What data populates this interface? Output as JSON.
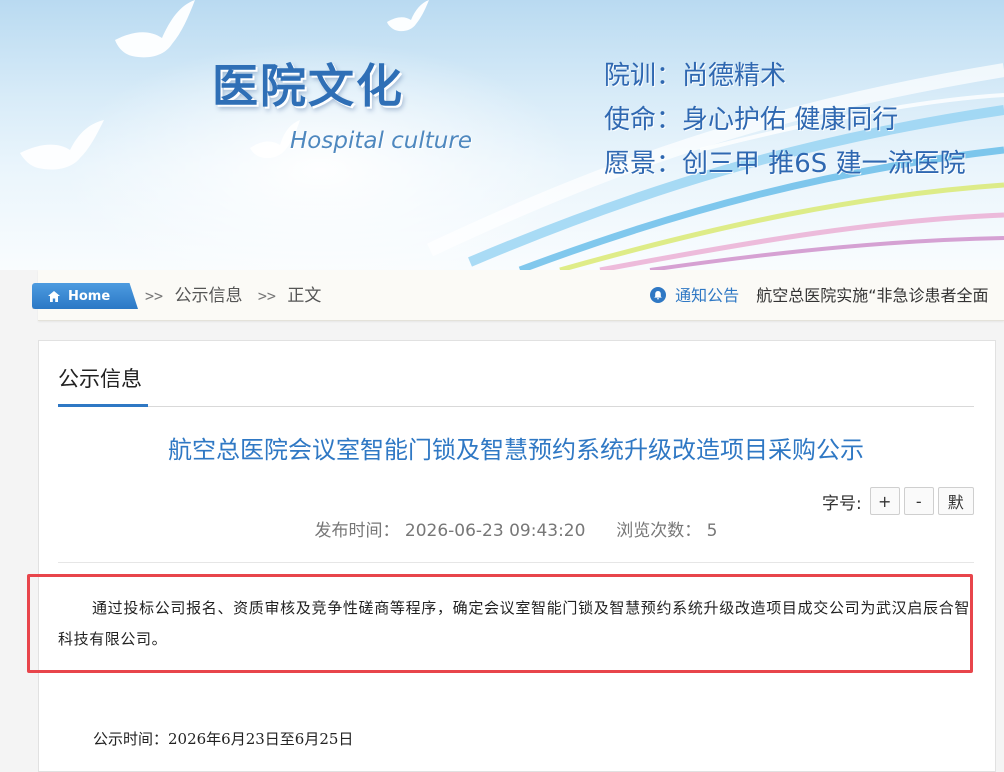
{
  "banner": {
    "title": "医院文化",
    "subtitle": "Hospital culture",
    "mottos": [
      "院训：尚德精术",
      "使命：身心护佑 健康同行",
      "愿景：创三甲 推6S 建一流医院"
    ]
  },
  "breadcrumb": {
    "home_label": "Home",
    "separator": ">>",
    "items": [
      "公示信息",
      "正文"
    ]
  },
  "notice": {
    "label": "通知公告",
    "text": "航空总医院实施“非急诊患者全面"
  },
  "section": {
    "title": "公示信息"
  },
  "article": {
    "title": "航空总医院会议室智能门锁及智慧预约系统升级改造项目采购公示",
    "publish_label": "发布时间：",
    "publish_time": "2026-06-23 09:43:20",
    "views_label": "浏览次数：",
    "views": "5",
    "font_size_label": "字号:",
    "font_buttons": [
      "+",
      "-",
      "默"
    ],
    "body": "通过投标公司报名、资质审核及竞争性磋商等程序，确定会议室智能门锁及智慧预约系统升级改造项目成交公司为武汉启辰合智科技有限公司。",
    "publicity_period": "公示时间：2026年6月23日至6月25日"
  },
  "colors": {
    "accent_blue": "#2f78c4",
    "highlight_red": "#e8454b"
  }
}
